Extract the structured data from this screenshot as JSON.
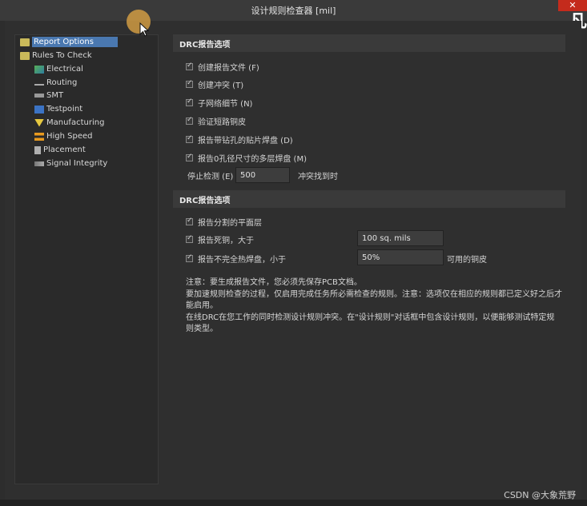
{
  "window": {
    "title": "设计规则检查器 [mil]",
    "close_label": "✕",
    "overlay_text": "凡仁"
  },
  "tree": {
    "items": [
      {
        "label": "Report Options",
        "icon": "folder-icon"
      },
      {
        "label": "Rules To Check",
        "icon": "folder-icon"
      },
      {
        "label": "Electrical",
        "icon": "electrical-icon"
      },
      {
        "label": "Routing",
        "icon": "routing-icon"
      },
      {
        "label": "SMT",
        "icon": "smt-icon"
      },
      {
        "label": "Testpoint",
        "icon": "testpoint-icon"
      },
      {
        "label": "Manufacturing",
        "icon": "manufacturing-icon"
      },
      {
        "label": "High Speed",
        "icon": "high-speed-icon"
      },
      {
        "label": "Placement",
        "icon": "placement-icon"
      },
      {
        "label": "Signal Integrity",
        "icon": "signal-integrity-icon"
      }
    ]
  },
  "section1": {
    "header": "DRC报告选项",
    "options": [
      "创建报告文件 (F)",
      "创建冲突 (T)",
      "子网络细节 (N)",
      "验证短路铜皮",
      "报告带钻孔的贴片焊盘 (D)",
      "报告0孔径尺寸的多层焊盘 (M)"
    ],
    "stop_label": "停止检测 (E)",
    "stop_value": "500",
    "stop_suffix": "冲突找到时"
  },
  "section2": {
    "header": "DRC报告选项",
    "options": [
      "报告分割的平面层",
      "报告死铜，大于",
      "报告不完全热焊盘，小于"
    ],
    "dead_copper_value": "100 sq. mils",
    "thermal_value": "50%",
    "thermal_suffix": "可用的铜皮"
  },
  "note": {
    "lines": [
      "注意：要生成报告文件，您必须先保存PCB文档。",
      "要加速规则检查的过程，仅启用完成任务所必需检查的规则。注意：选项仅在相应的规则都已定义好之后才能启用。",
      "在线DRC在您工作的同时检测设计规则冲突。在\"设计规则\"对话框中包含设计规则，以便能够测试特定规则类型。"
    ]
  },
  "watermark": "CSDN @大象荒野"
}
